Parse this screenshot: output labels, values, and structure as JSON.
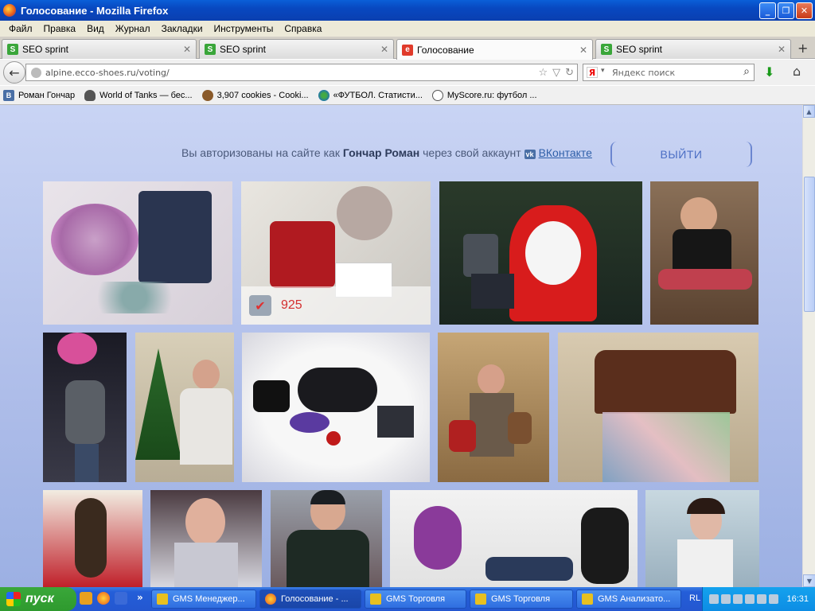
{
  "window": {
    "title": "Голосование - Mozilla Firefox"
  },
  "menu": [
    "Файл",
    "Правка",
    "Вид",
    "Журнал",
    "Закладки",
    "Инструменты",
    "Справка"
  ],
  "tabs": [
    {
      "label": "SEO sprint"
    },
    {
      "label": "SEO sprint"
    },
    {
      "label": "Голосование"
    },
    {
      "label": "SEO sprint"
    }
  ],
  "address": {
    "url": "alpine.ecco-shoes.ru/voting/"
  },
  "search": {
    "placeholder": "Яндекс поиск"
  },
  "bookmarks": [
    {
      "label": "Роман Гончар"
    },
    {
      "label": "World of Tanks — бес..."
    },
    {
      "label": "3,907 cookies - Cooki..."
    },
    {
      "label": "«ФУТБОЛ. Статисти..."
    },
    {
      "label": "MyScore.ru: футбол ..."
    }
  ],
  "page": {
    "auth_prefix": "Вы авторизованы на сайте как",
    "auth_name": "Гончар Роман",
    "auth_middle": "через свой аккаунт",
    "vk_label": "ВКонтакте",
    "logout_label": "ВЫЙТИ",
    "like_count": "925"
  },
  "taskbar": {
    "start_label": "пуск",
    "tasks": [
      {
        "label": "GMS Менеджер..."
      },
      {
        "label": "Голосование - ..."
      },
      {
        "label": "GMS Торговля"
      },
      {
        "label": "GMS Торговля"
      },
      {
        "label": "GMS Анализато..."
      }
    ],
    "lang": "RL",
    "clock": "16:31"
  },
  "colors": {
    "page_bg": "#b6c4ee",
    "like_count": "#d42e2e",
    "logout": "#4b6ec4"
  }
}
